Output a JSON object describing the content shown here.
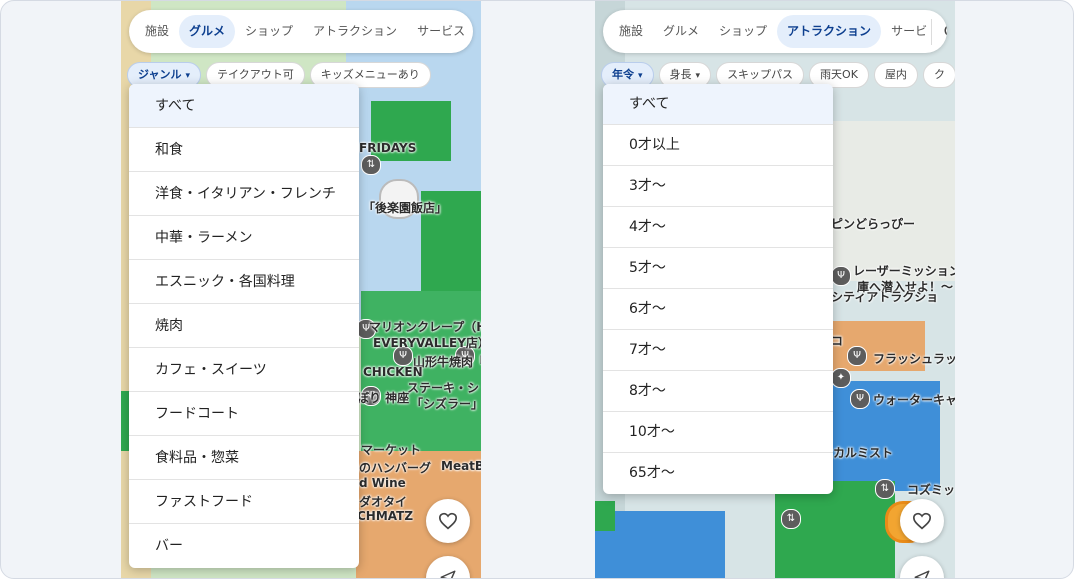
{
  "left_screen": {
    "tabs": [
      {
        "label": "施設",
        "active": false
      },
      {
        "label": "グルメ",
        "active": true
      },
      {
        "label": "ショップ",
        "active": false
      },
      {
        "label": "アトラクション",
        "active": false
      },
      {
        "label": "サービス",
        "active": false
      }
    ],
    "filters": [
      {
        "label": "ジャンル",
        "active": true,
        "dropdown": true
      },
      {
        "label": "テイクアウト可",
        "active": false
      },
      {
        "label": "キッズメニューあり",
        "active": false
      }
    ],
    "dropdown_options": [
      "すべて",
      "和食",
      "洋食・イタリアン・フレンチ",
      "中華・ラーメン",
      "エスニック・各国料理",
      "焼肉",
      "カフェ・スイーツ",
      "フードコート",
      "食料品・惣菜",
      "ファストフード",
      "バー"
    ],
    "selected_option": "すべて",
    "map_labels": [
      "FRIDAYS",
      "「後楽園飯店」",
      "マリオンクレープ（H",
      "EVERYVALLEY店）",
      "山形牛焼肉「",
      "CHICKEN",
      "ステーキ・シ",
      "ぼり 神座",
      "「シズラー」",
      "マーケット",
      "のハンバーグ",
      "MeatB",
      "d Wine",
      "ダオタイ",
      "CHMATZ"
    ]
  },
  "right_screen": {
    "tabs": [
      {
        "label": "施設",
        "active": false
      },
      {
        "label": "グルメ",
        "active": false
      },
      {
        "label": "ショップ",
        "active": false
      },
      {
        "label": "アトラクション",
        "active": true
      },
      {
        "label": "サービ",
        "active": false
      }
    ],
    "filters": [
      {
        "label": "年令",
        "active": true,
        "dropdown": true
      },
      {
        "label": "身長",
        "active": false,
        "dropdown": true
      },
      {
        "label": "スキップパス",
        "active": false
      },
      {
        "label": "雨天OK",
        "active": false
      },
      {
        "label": "屋内",
        "active": false
      },
      {
        "label": "ク",
        "active": false
      }
    ],
    "dropdown_options": [
      "すべて",
      "0才以上",
      "3才〜",
      "4才〜",
      "5才〜",
      "6才〜",
      "7才〜",
      "8才〜",
      "10才〜",
      "65才〜"
    ],
    "selected_option": "すべて",
    "map_labels": [
      "ピンどらっぴー",
      "レーザーミッション",
      "庫へ潜入せよ！〜",
      "シティアトラクショ",
      "コ",
      "フラッシュラッ",
      "ウォーターキャ",
      "カルミスト",
      "コズミッ"
    ]
  },
  "icons": [
    "search-icon",
    "heart-icon",
    "navigate-icon",
    "chevron-down-icon",
    "restaurant-pin-icon",
    "elevator-icon"
  ],
  "colors": {
    "active_tab_bg": "#e4eefb",
    "active_text": "#0d3f8f",
    "map_green": "#2fa84f",
    "map_blue": "#3f8fd8"
  }
}
